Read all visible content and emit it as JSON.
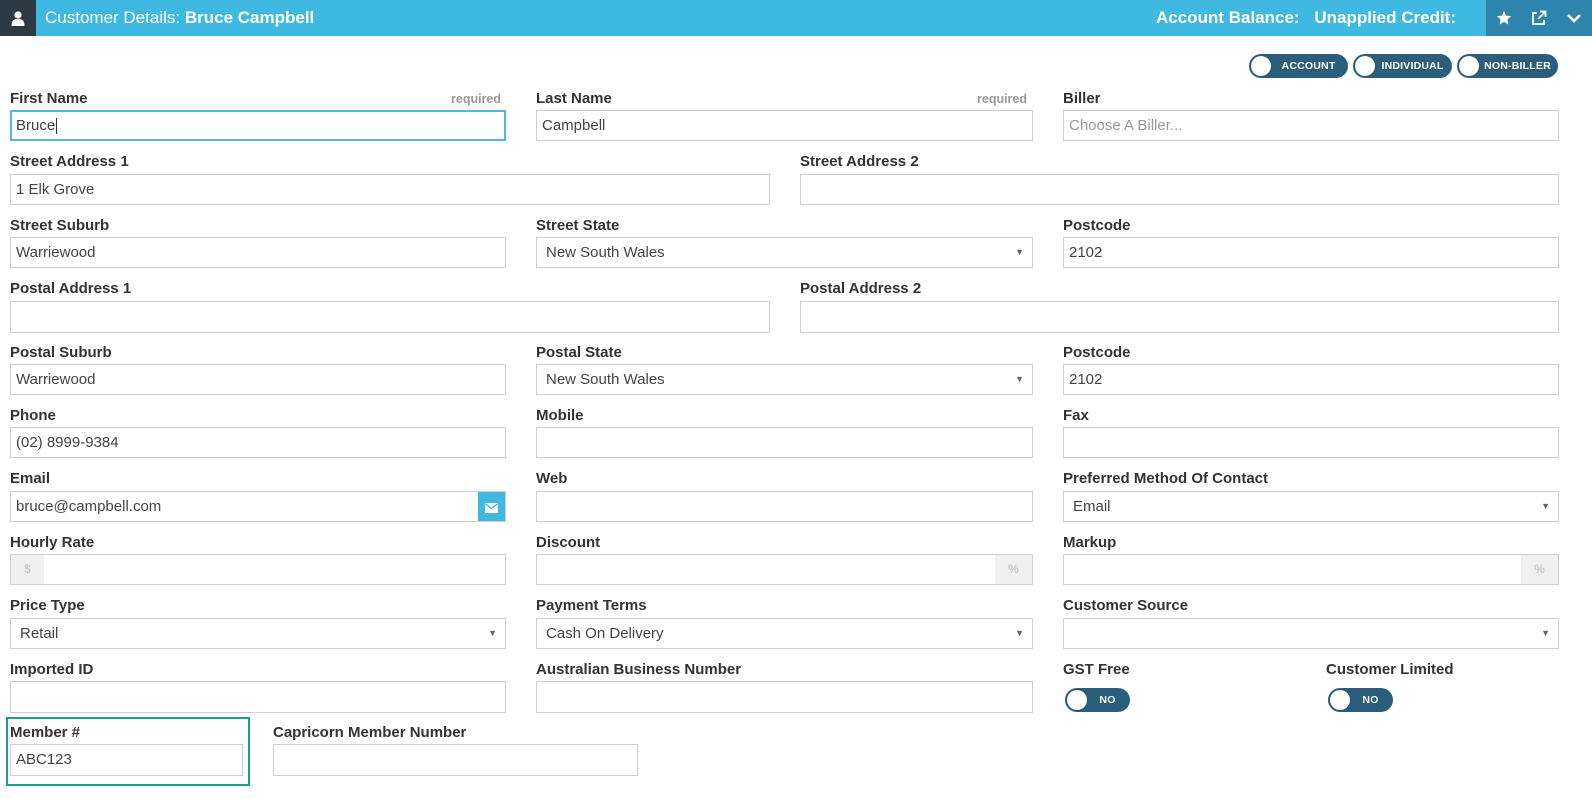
{
  "header": {
    "title_prefix": "Customer Details:",
    "customer_name": "Bruce Campbell",
    "account_balance_label": "Account Balance:",
    "unapplied_credit_label": "Unapplied Credit:",
    "icons": [
      "user-icon",
      "star-icon",
      "external-link-icon",
      "chevron-down-icon"
    ],
    "colors": {
      "bar": "#3fb9e2",
      "user_box": "#2b3a45",
      "actions": "#2d84ad"
    }
  },
  "toggles": {
    "account": "ACCOUNT",
    "individual": "INDIVIDUAL",
    "non_biller": "NON-BILLER"
  },
  "form": {
    "required_text": "required",
    "first_name": {
      "label": "First Name",
      "value": "Bruce"
    },
    "last_name": {
      "label": "Last Name",
      "value": "Campbell"
    },
    "biller": {
      "label": "Biller",
      "placeholder": "Choose A Biller..."
    },
    "street_address_1": {
      "label": "Street Address 1",
      "value": "1 Elk Grove"
    },
    "street_address_2": {
      "label": "Street Address 2",
      "value": ""
    },
    "street_suburb": {
      "label": "Street Suburb",
      "value": "Warriewood"
    },
    "street_state": {
      "label": "Street State",
      "value": "New South Wales"
    },
    "street_postcode": {
      "label": "Postcode",
      "value": "2102"
    },
    "postal_address_1": {
      "label": "Postal Address 1",
      "value": ""
    },
    "postal_address_2": {
      "label": "Postal Address 2",
      "value": ""
    },
    "postal_suburb": {
      "label": "Postal Suburb",
      "value": "Warriewood"
    },
    "postal_state": {
      "label": "Postal State",
      "value": "New South Wales"
    },
    "postal_postcode": {
      "label": "Postcode",
      "value": "2102"
    },
    "phone": {
      "label": "Phone",
      "value": "(02) 8999-9384"
    },
    "mobile": {
      "label": "Mobile",
      "value": ""
    },
    "fax": {
      "label": "Fax",
      "value": ""
    },
    "email": {
      "label": "Email",
      "value": "bruce@campbell.com"
    },
    "web": {
      "label": "Web",
      "value": ""
    },
    "preferred_contact": {
      "label": "Preferred Method Of Contact",
      "value": "Email"
    },
    "hourly_rate": {
      "label": "Hourly Rate",
      "addon": "$",
      "value": ""
    },
    "discount": {
      "label": "Discount",
      "addon": "%",
      "value": ""
    },
    "markup": {
      "label": "Markup",
      "addon": "%",
      "value": ""
    },
    "price_type": {
      "label": "Price Type",
      "value": "Retail"
    },
    "payment_terms": {
      "label": "Payment Terms",
      "value": "Cash On Delivery"
    },
    "customer_source": {
      "label": "Customer Source",
      "value": ""
    },
    "imported_id": {
      "label": "Imported ID",
      "value": ""
    },
    "abn": {
      "label": "Australian Business Number",
      "value": ""
    },
    "gst_free": {
      "label": "GST Free",
      "toggle": "NO"
    },
    "customer_limited": {
      "label": "Customer Limited",
      "toggle": "NO"
    },
    "member_number": {
      "label": "Member #",
      "value": "ABC123"
    },
    "capricorn_member_number": {
      "label": "Capricorn Member Number",
      "value": ""
    }
  }
}
